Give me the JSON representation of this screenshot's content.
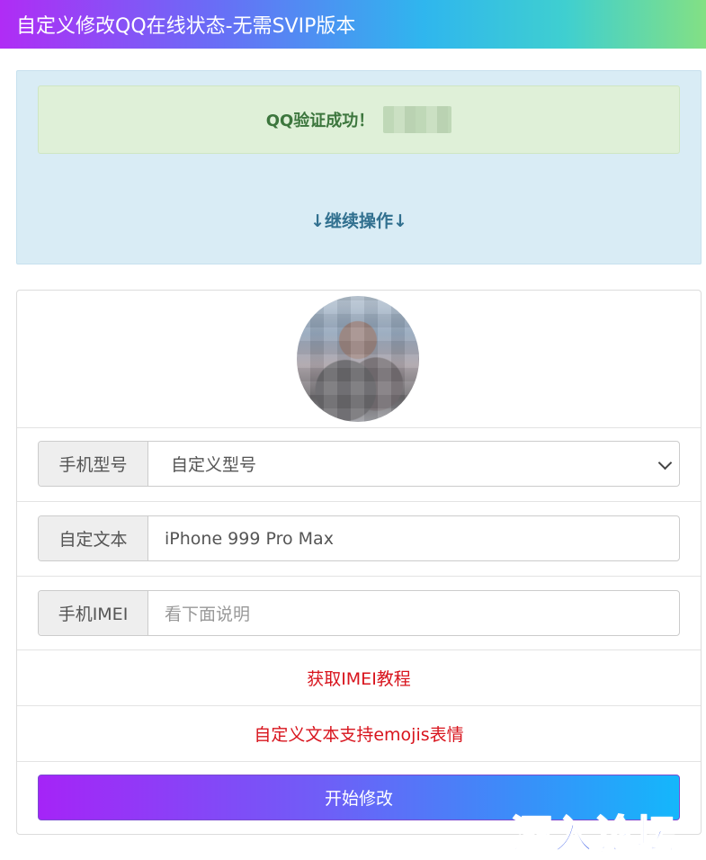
{
  "header": {
    "title": "自定义修改QQ在线状态-无需SVIP版本"
  },
  "notice": {
    "success_message": "QQ验证成功！",
    "continue_label": "↓继续操作↓"
  },
  "form": {
    "model": {
      "label": "手机型号",
      "selected": "自定义型号",
      "icon": "chevron-down-icon"
    },
    "custom_text": {
      "label": "自定文本",
      "value": "iPhone 999 Pro Max"
    },
    "imei": {
      "label": "手机IMEI",
      "value": "",
      "placeholder": "看下面说明"
    },
    "tutorial_link": "获取IMEI教程",
    "emoji_note": "自定义文本支持emojis表情",
    "submit_label": "开始修改"
  },
  "watermark": {
    "text": "酒入论坛"
  },
  "colors": {
    "accent_purple": "#a524f7",
    "accent_blue": "#14b7fb",
    "success_green": "#3c763d",
    "info_blue": "#31708f",
    "link_red": "#d8141d"
  }
}
